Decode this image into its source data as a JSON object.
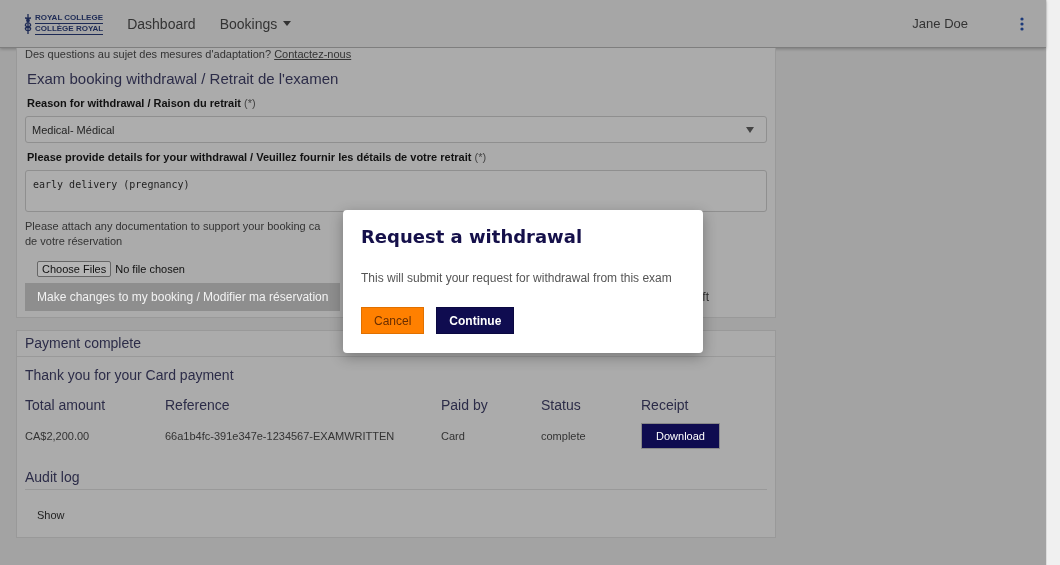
{
  "header": {
    "logo": [
      "ROYAL COLLEGE",
      "COLLÈGE ROYAL"
    ],
    "nav": [
      {
        "label": "Dashboard",
        "dropdown": false
      },
      {
        "label": "Bookings",
        "dropdown": true
      }
    ],
    "user": "Jane Doe"
  },
  "notice": {
    "text": "Des questions au sujet des mesures d'adaptation?",
    "link": "Contactez-nous"
  },
  "withdrawal_form": {
    "title": "Exam booking withdrawal / Retrait de l'examen",
    "reason": {
      "label": "Reason for withdrawal / Raison du retrait",
      "required": "(*)",
      "value": "Medical- Médical"
    },
    "details": {
      "label": "Please provide details for your withdrawal / Veuillez fournir les détails de votre retrait",
      "required": "(*)",
      "value": "early delivery (pregnancy)"
    },
    "attach_text": [
      "Please attach any documentation to support your booking ca",
      "de votre réservation"
    ],
    "file": {
      "button": "Choose Files",
      "status": "No file chosen"
    },
    "actions": [
      {
        "label": "Make changes to my booking / Modifier ma réservation",
        "kind": "button",
        "disabled": true
      },
      {
        "label": "ft",
        "kind": "link",
        "disabled": false
      }
    ]
  },
  "payment": {
    "title": "Payment complete",
    "subtitle": "Thank you for your Card payment",
    "columns": [
      "Total amount",
      "Reference",
      "Paid by",
      "Status",
      "Receipt"
    ],
    "row": {
      "amount": "CA$2,200.00",
      "reference": "66a1b4fc-391e347e-1234567-EXAMWRITTEN",
      "paid_by": "Card",
      "status": "complete",
      "receipt": "Download"
    },
    "audit": {
      "title": "Audit log",
      "toggle": "Show"
    }
  },
  "dialog": {
    "title": "Request a withdrawal",
    "message": "This will submit your request for withdrawal from this exam",
    "buttons": [
      {
        "label": "Cancel",
        "kind": "secondary"
      },
      {
        "label": "Continue",
        "kind": "primary"
      }
    ]
  }
}
